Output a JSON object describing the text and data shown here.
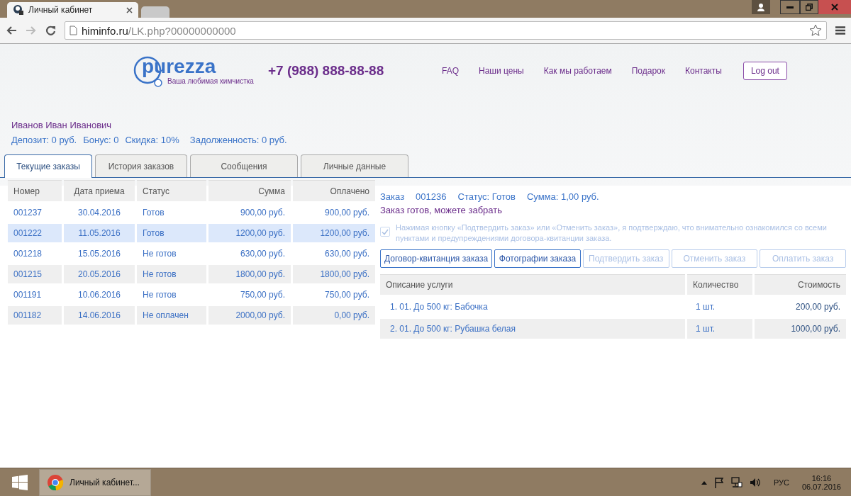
{
  "browser": {
    "tabs": [
      {
        "title": "Личный кабинет",
        "selected": true
      },
      {
        "selected": false
      }
    ],
    "url_host": "himinfo.ru",
    "url_path": "/LK.php?00000000000"
  },
  "header": {
    "logo": "purezza",
    "tagline": "Ваша любимая химчистка",
    "phone": "+7 (988) 888-88-88",
    "nav": [
      "FAQ",
      "Наши цены",
      "Как мы работаем",
      "Подарок",
      "Контакты"
    ],
    "logout": "Log out"
  },
  "user": {
    "name": "Иванов Иван Иванович",
    "stats": [
      "Депозит: 0 руб.",
      "Бонус: 0",
      "Скидка: 10%",
      "Задолженность: 0 руб."
    ]
  },
  "tabs": [
    {
      "label": "Текущие заказы",
      "selected": true
    },
    {
      "label": "История заказов",
      "selected": false
    },
    {
      "label": "Сообщения",
      "selected": false
    },
    {
      "label": "Личные данные",
      "selected": false
    }
  ],
  "orders": {
    "columns": [
      "Номер",
      "Дата приема",
      "Статус",
      "Сумма",
      "Оплачено"
    ],
    "rows": [
      {
        "cells": [
          "001237",
          "30.04.2016",
          "Готов",
          "900,00 руб.",
          "900,00 руб."
        ],
        "selected": false
      },
      {
        "cells": [
          "001222",
          "11.05.2016",
          "Готов",
          "1200,00 руб.",
          "1200,00 руб."
        ],
        "selected": true
      },
      {
        "cells": [
          "001218",
          "15.05.2016",
          "Не готов",
          "630,00 руб.",
          "630,00 руб."
        ],
        "selected": false
      },
      {
        "cells": [
          "001215",
          "20.05.2016",
          "Не готов",
          "1800,00 руб.",
          "1800,00 руб."
        ],
        "selected": false
      },
      {
        "cells": [
          "001191",
          "10.06.2016",
          "Не готов",
          "750,00 руб.",
          "750,00 руб."
        ],
        "selected": false
      },
      {
        "cells": [
          "001182",
          "14.06.2016",
          "Не оплачен",
          "2000,00 руб.",
          "0,00 руб."
        ],
        "selected": false
      }
    ]
  },
  "order_detail": {
    "label": "Заказ",
    "number": "001236",
    "status": "Статус: Готов",
    "sum": "Сумма: 1,00 руб.",
    "message": "Заказ готов, можете забрать",
    "agreement": {
      "checked": true,
      "disabled": true,
      "text": "Нажимая кнопку «Подтвердить заказ» или «Отменить заказ», я подтверждаю, что внимательно ознакомился со всеми пунктами и предупреждениями договора-квитанции заказа."
    },
    "buttons": [
      {
        "label": "Договор-квитанция заказа",
        "disabled": false
      },
      {
        "label": "Фотографии заказа",
        "disabled": false
      },
      {
        "label": "Подтвердить заказ",
        "disabled": true
      },
      {
        "label": "Отменить заказ",
        "disabled": true
      },
      {
        "label": "Оплатить заказ",
        "disabled": true
      }
    ],
    "services": {
      "columns": [
        "Описание услуги",
        "Количество",
        "Стоимость"
      ],
      "rows": [
        {
          "cells": [
            "1. 01. До 500 кг: Бабочка",
            "1 шт.",
            "200,00 руб."
          ]
        },
        {
          "cells": [
            "2. 01. До 500 кг: Рубашка белая",
            "1 шт.",
            "1000,00 руб."
          ]
        }
      ]
    }
  },
  "taskbar": {
    "app_title": "Личный кабинет...",
    "language": "РУС",
    "time": "16:16",
    "date": "06.07.2016"
  }
}
